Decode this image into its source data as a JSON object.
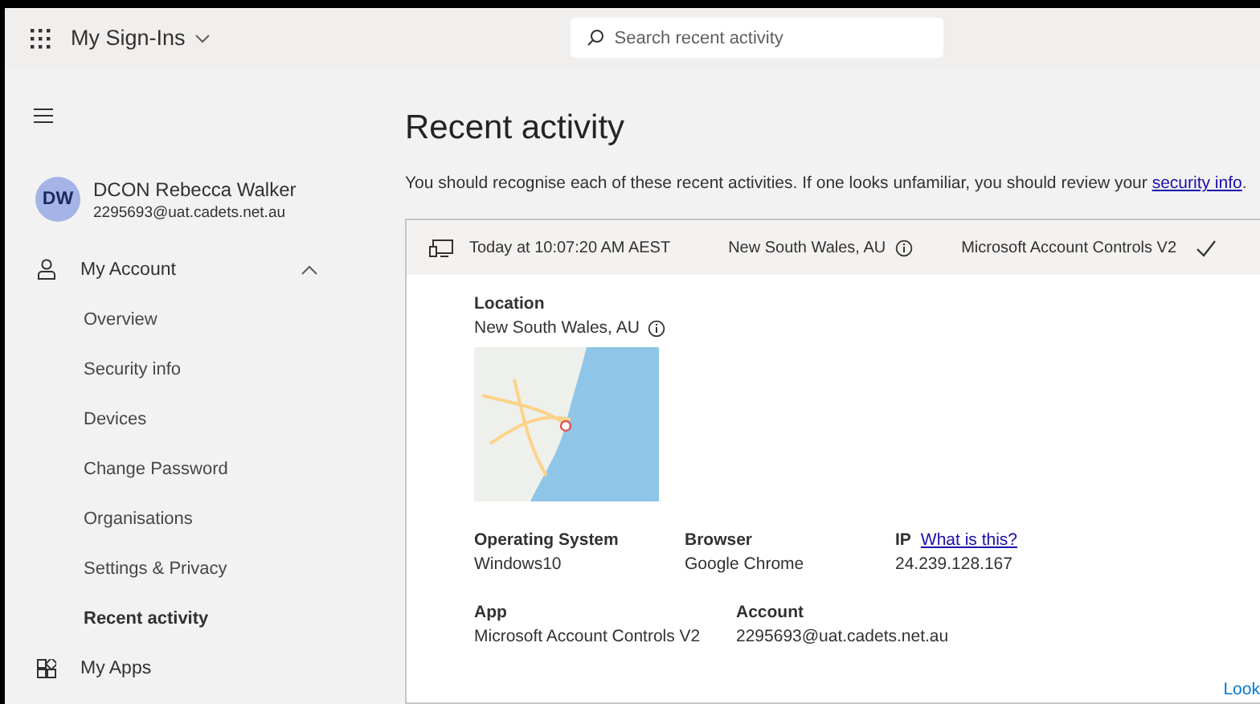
{
  "app_bar": {
    "title": "My Sign-Ins",
    "search": {
      "placeholder": "Search recent activity"
    }
  },
  "sidebar": {
    "user": {
      "initials": "DW",
      "name": "DCON Rebecca Walker",
      "email": "2295693@uat.cadets.net.au"
    },
    "sections": [
      {
        "kind": "account",
        "label": "My Account",
        "expanded": true,
        "children": [
          {
            "label": "Overview",
            "selected": false
          },
          {
            "label": "Security info",
            "selected": false
          },
          {
            "label": "Devices",
            "selected": false
          },
          {
            "label": "Change Password",
            "selected": false
          },
          {
            "label": "Organisations",
            "selected": false
          },
          {
            "label": "Settings & Privacy",
            "selected": false
          },
          {
            "label": "Recent activity",
            "selected": true
          }
        ]
      },
      {
        "kind": "apps",
        "label": "My Apps"
      }
    ]
  },
  "main": {
    "title": "Recent activity",
    "intro": "You should recognise each of these recent activities. If one looks unfamiliar, you should review your",
    "intro_link": "security info",
    "intro_end": ".",
    "activity": {
      "time": "Today at 10:07:20 AM AEST",
      "location": "New South Wales, AU",
      "app": "Microsoft Account Controls V2",
      "success": true,
      "details": {
        "location_label": "Location",
        "location_value": "New South Wales, AU",
        "rows": [
          [
            {
              "label": "Operating System",
              "value": "Windows10"
            },
            {
              "label": "Browser",
              "value": "Google Chrome"
            },
            {
              "label": "IP",
              "link": "What is this?",
              "value": "24.239.128.167"
            }
          ],
          [
            {
              "label": "App",
              "value": "Microsoft Account Controls V2"
            },
            {
              "label": "Account",
              "value": "2295693@uat.cadets.net.au"
            }
          ]
        ]
      },
      "footer_link": "Look"
    }
  }
}
